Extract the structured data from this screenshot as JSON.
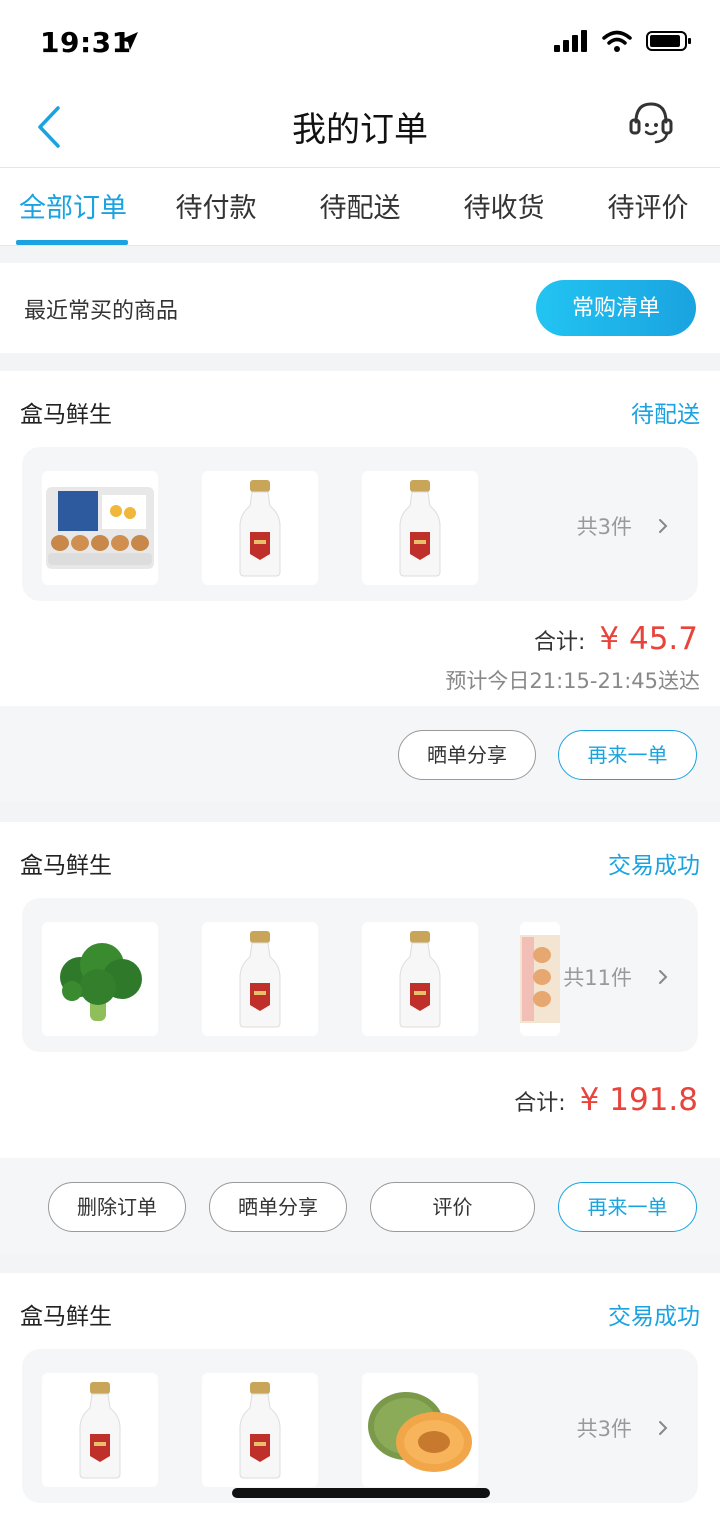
{
  "status_bar": {
    "time": "19:31"
  },
  "nav": {
    "title": "我的订单"
  },
  "tabs": [
    "全部订单",
    "待付款",
    "待配送",
    "待收货",
    "待评价"
  ],
  "recent": {
    "label": "最近常买的商品",
    "button": "常购清单"
  },
  "orders": [
    {
      "shop": "盒马鲜生",
      "status": "待配送",
      "products": [
        "eggs-icon",
        "milk-bottle-icon",
        "milk-bottle-icon"
      ],
      "count": "共3件",
      "total_label": "合计:",
      "price": "¥ 45.7",
      "eta": "预计今日21:15-21:45送达",
      "actions": [
        "晒单分享",
        "再来一单"
      ]
    },
    {
      "shop": "盒马鲜生",
      "status": "交易成功",
      "products": [
        "broccoli-icon",
        "milk-bottle-icon",
        "milk-bottle-icon",
        "eggs-icon"
      ],
      "count": "共11件",
      "total_label": "合计:",
      "price": "¥ 191.8",
      "actions": [
        "删除订单",
        "晒单分享",
        "评价",
        "再来一单"
      ]
    },
    {
      "shop": "盒马鲜生",
      "status": "交易成功",
      "products": [
        "milk-bottle-icon",
        "milk-bottle-icon",
        "melon-icon"
      ],
      "count": "共3件"
    }
  ],
  "colors": {
    "accent": "#1aa3e0",
    "price": "#e8443b",
    "background": "#f3f4f6"
  }
}
